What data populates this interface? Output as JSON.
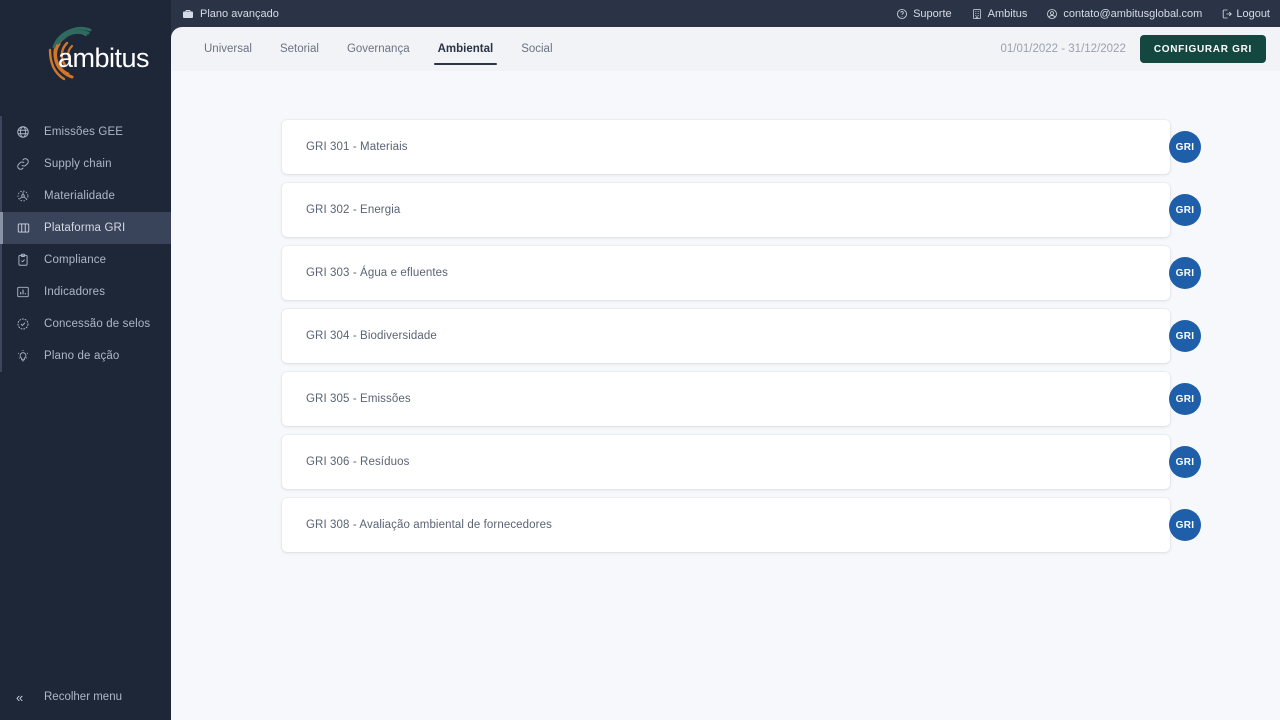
{
  "topbar": {
    "plan_label": "Plano avançado",
    "plan_icon": "briefcase-icon",
    "util": [
      {
        "label": "Suporte",
        "icon": "question-circle-icon"
      },
      {
        "label": "Ambitus",
        "icon": "building-icon"
      },
      {
        "label": "contato@ambitusglobal.com",
        "icon": "user-circle-icon"
      },
      {
        "label": "Logout",
        "icon": "logout-icon"
      }
    ]
  },
  "sidebar": {
    "logo_text": "ambitus",
    "items": [
      {
        "label": "Emissões GEE",
        "icon": "globe-icon",
        "active": false
      },
      {
        "label": "Supply chain",
        "icon": "link-icon",
        "active": false
      },
      {
        "label": "Materialidade",
        "icon": "atom-icon",
        "active": false
      },
      {
        "label": "Plataforma GRI",
        "icon": "columns-icon",
        "active": true
      },
      {
        "label": "Compliance",
        "icon": "clipboard-check-icon",
        "active": false
      },
      {
        "label": "Indicadores",
        "icon": "bar-chart-icon",
        "active": false
      },
      {
        "label": "Concessão de selos",
        "icon": "badge-check-icon",
        "active": false
      },
      {
        "label": "Plano de ação",
        "icon": "lightbulb-icon",
        "active": false
      }
    ],
    "collapse_label": "Recolher menu",
    "collapse_icon": "chevron-double-left-icon"
  },
  "navbar": {
    "tabs": [
      {
        "label": "Universal",
        "active": false
      },
      {
        "label": "Setorial",
        "active": false
      },
      {
        "label": "Governança",
        "active": false
      },
      {
        "label": "Ambiental",
        "active": true
      },
      {
        "label": "Social",
        "active": false
      }
    ],
    "date_range": "01/01/2022 - 31/12/2022",
    "configure_label": "CONFIGURAR GRI"
  },
  "main": {
    "cards": [
      {
        "title": "GRI 301 - Materiais",
        "badge": "GRI"
      },
      {
        "title": "GRI 302 - Energia",
        "badge": "GRI"
      },
      {
        "title": "GRI 303 - Água e efluentes",
        "badge": "GRI"
      },
      {
        "title": "GRI 304 - Biodiversidade",
        "badge": "GRI"
      },
      {
        "title": "GRI 305 - Emissões",
        "badge": "GRI"
      },
      {
        "title": "GRI 306 - Resíduos",
        "badge": "GRI"
      },
      {
        "title": "GRI 308 - Avaliação ambiental de fornecedores",
        "badge": "GRI"
      }
    ]
  },
  "colors": {
    "sidebar_bg": "#1e2738",
    "topbar_bg": "#2b3446",
    "navbar_bg": "#f2f3f6",
    "content_bg": "#f7f8fb",
    "accent_button": "#14473f",
    "badge_blue": "#1f5fa9",
    "logo_orange": "#d2762c",
    "logo_green": "#2f6b5e"
  }
}
